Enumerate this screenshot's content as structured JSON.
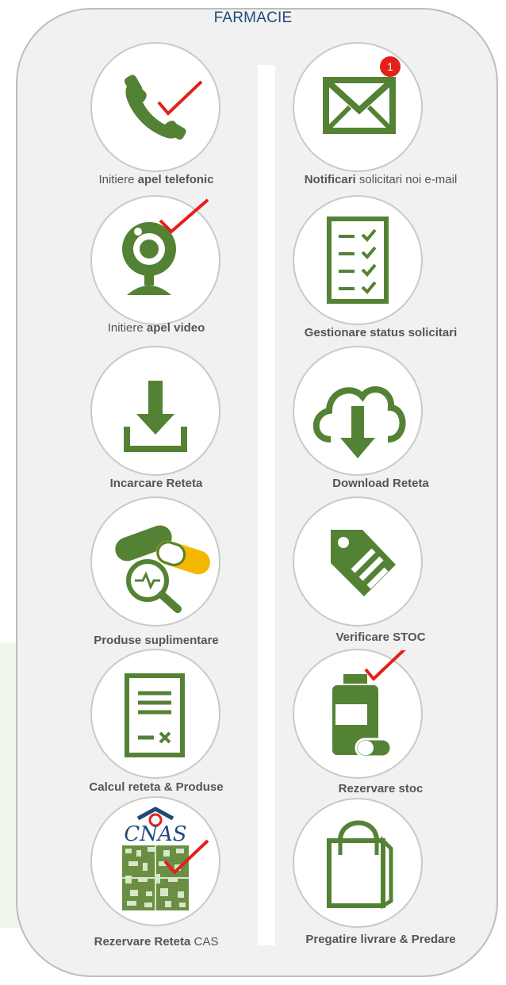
{
  "panel": {
    "title": "FARMACIE"
  },
  "left": [
    {
      "pre": "Initiere ",
      "bold": "apel telefonic",
      "post": ""
    },
    {
      "pre": "Initiere ",
      "bold": "apel video",
      "post": ""
    },
    {
      "pre": "",
      "bold": "Incarcare Reteta",
      "post": ""
    },
    {
      "pre": "",
      "bold": "Produse suplimentare",
      "post": ""
    },
    {
      "pre": "",
      "bold": "Calcul reteta & Produse",
      "post": ""
    },
    {
      "pre": "",
      "bold": "Rezervare Reteta",
      "post": " CAS"
    }
  ],
  "right": [
    {
      "pre": "",
      "bold": "Notificari",
      "post": " solicitari noi e-mail",
      "badge": "1"
    },
    {
      "pre": "",
      "bold": "Gestionare status solicitari",
      "post": ""
    },
    {
      "pre": "",
      "bold": "Download Reteta",
      "post": ""
    },
    {
      "pre": "",
      "bold": "Verificare STOC",
      "post": ""
    },
    {
      "pre": "",
      "bold": "Rezervare stoc",
      "post": ""
    },
    {
      "pre": "",
      "bold": "Pregatire livrare & Predare",
      "post": ""
    }
  ],
  "cnas_logo_text": "CNAS",
  "colors": {
    "icon_green": "#548235",
    "check_red": "#e3201b",
    "title_blue": "#1f4a7a",
    "pill_yellow": "#f5b800"
  }
}
